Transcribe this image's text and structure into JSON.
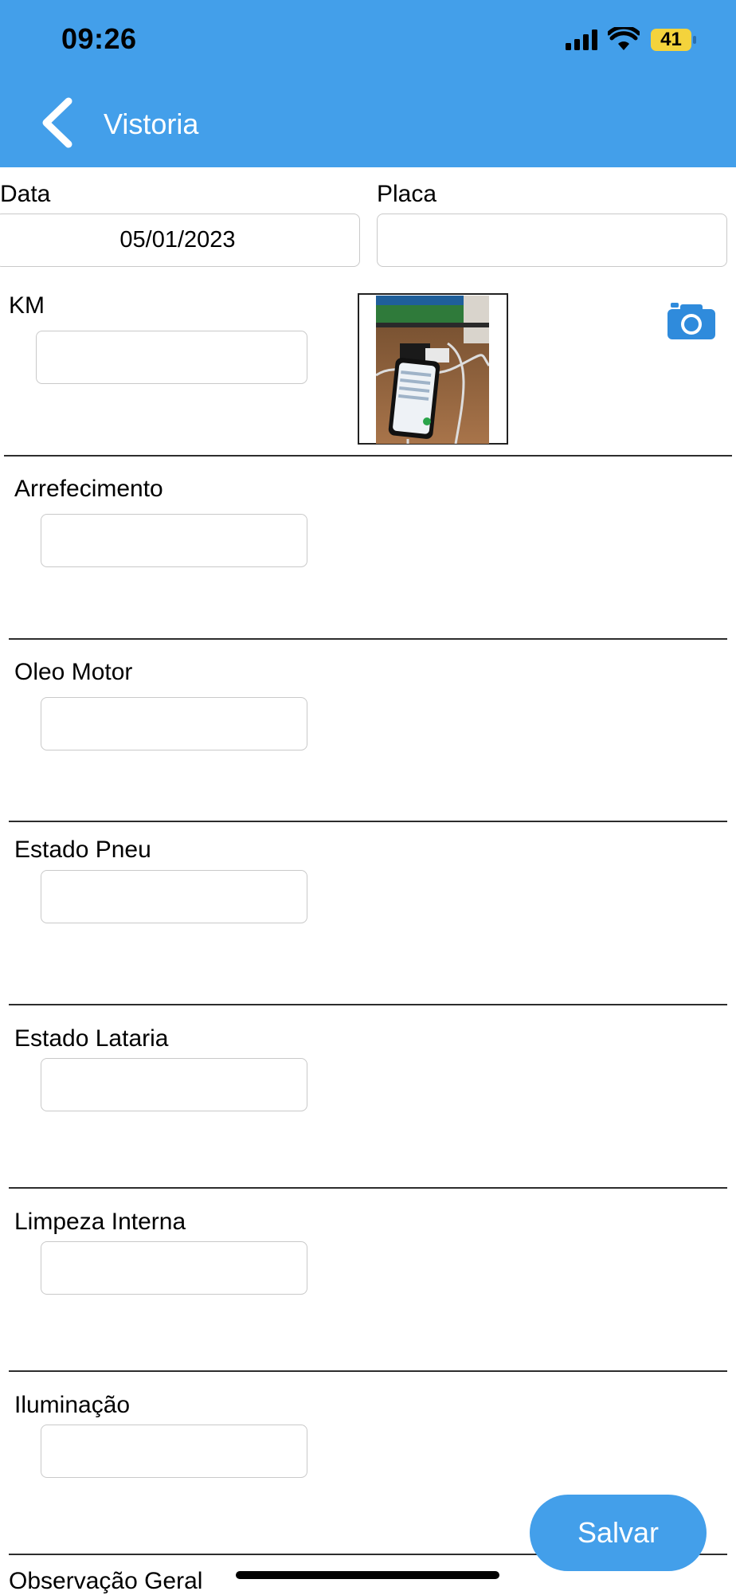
{
  "status_bar": {
    "time": "09:26",
    "battery": "41"
  },
  "header": {
    "title": "Vistoria",
    "back_icon": "chevron-left-icon"
  },
  "form": {
    "data_label": "Data",
    "data_value": "05/01/2023",
    "placa_label": "Placa",
    "placa_value": "",
    "km_label": "KM",
    "km_value": "",
    "photo_icon": "camera-icon",
    "items": [
      {
        "label": "Arrefecimento",
        "value": ""
      },
      {
        "label": "Oleo Motor",
        "value": ""
      },
      {
        "label": "Estado Pneu",
        "value": ""
      },
      {
        "label": "Estado Lataria",
        "value": ""
      },
      {
        "label": "Limpeza Interna",
        "value": ""
      },
      {
        "label": "Iluminação",
        "value": ""
      }
    ],
    "observacao_label": "Observação Geral",
    "save_label": "Salvar"
  },
  "colors": {
    "accent": "#439fea",
    "battery": "#f4d33c"
  }
}
